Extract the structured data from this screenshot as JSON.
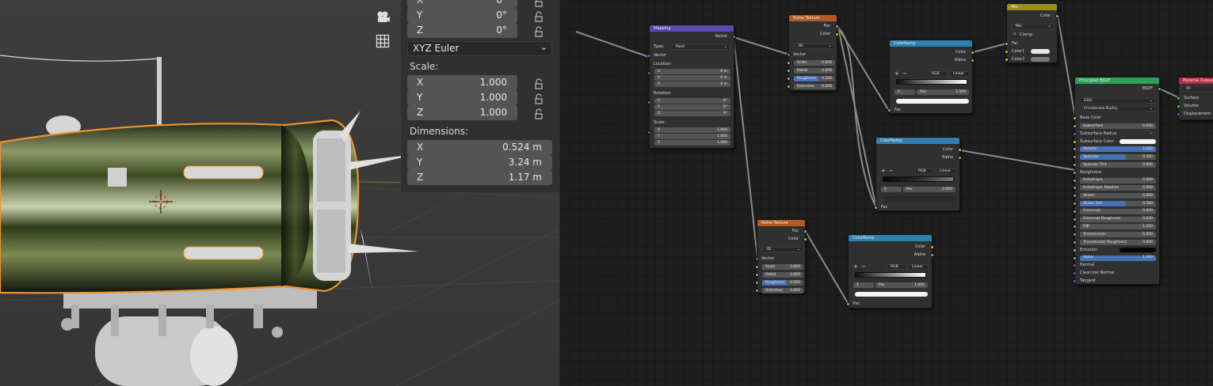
{
  "viewport": {
    "gizmos": [
      "camera-icon",
      "grid-icon"
    ],
    "rotation_rows": [
      {
        "axis": "X",
        "value": "0°"
      },
      {
        "axis": "Y",
        "value": "0°"
      },
      {
        "axis": "Z",
        "value": "0°"
      }
    ],
    "rotation_mode": "XYZ Euler",
    "scale_label": "Scale:",
    "scale_rows": [
      {
        "axis": "X",
        "value": "1.000"
      },
      {
        "axis": "Y",
        "value": "1.000"
      },
      {
        "axis": "Z",
        "value": "1.000"
      }
    ],
    "dimensions_label": "Dimensions:",
    "dimension_rows": [
      {
        "axis": "X",
        "value": "0.524 m"
      },
      {
        "axis": "Y",
        "value": "3.24 m"
      },
      {
        "axis": "Z",
        "value": "1.17 m"
      }
    ]
  },
  "node_editor": {
    "mapping": {
      "title": "Mapping",
      "out_vector": "Vector",
      "type_label": "Type:",
      "type_value": "Point",
      "in_vector": "Vector",
      "location_label": "Location:",
      "location": [
        {
          "a": "X",
          "v": "0 m"
        },
        {
          "a": "Y",
          "v": "0 m"
        },
        {
          "a": "Z",
          "v": "0 m"
        }
      ],
      "rotation_label": "Rotation:",
      "rotation": [
        {
          "a": "X",
          "v": "0°"
        },
        {
          "a": "Y",
          "v": "0°"
        },
        {
          "a": "Z",
          "v": "0°"
        }
      ],
      "scale_label": "Scale:",
      "scale": [
        {
          "a": "X",
          "v": "1.000"
        },
        {
          "a": "Y",
          "v": "1.000"
        },
        {
          "a": "Z",
          "v": "1.000"
        }
      ]
    },
    "noise1": {
      "title": "Noise Texture",
      "out_fac": "Fac",
      "out_color": "Color",
      "dim": "3D",
      "in_vector": "Vector",
      "fields": [
        {
          "a": "Scale",
          "v": "5.000"
        },
        {
          "a": "Detail",
          "v": "4.000"
        },
        {
          "a": "Roughness",
          "v": "0.500"
        },
        {
          "a": "Distortion",
          "v": "0.000"
        }
      ]
    },
    "noise2": {
      "title": "Noise Texture",
      "out_fac": "Fac",
      "out_color": "Color",
      "dim": "3D",
      "in_vector": "Vector",
      "fields": [
        {
          "a": "Scale",
          "v": "5.000"
        },
        {
          "a": "Detail",
          "v": "2.000"
        },
        {
          "a": "Roughness",
          "v": "0.500"
        },
        {
          "a": "Distortion",
          "v": "0.000"
        }
      ]
    },
    "ramp1": {
      "title": "ColorRamp",
      "out_color": "Color",
      "out_alpha": "Alpha",
      "mode": "RGB",
      "interp": "Linear",
      "index": "1",
      "pos_label": "Pos",
      "pos": "1.000",
      "in_fac": "Fac"
    },
    "ramp2": {
      "title": "ColorRamp",
      "out_color": "Color",
      "out_alpha": "Alpha",
      "mode": "RGB",
      "interp": "Linear",
      "index": "0",
      "pos_label": "Pos",
      "pos": "0.000",
      "in_fac": "Fac"
    },
    "ramp3": {
      "title": "ColorRamp",
      "out_color": "Color",
      "out_alpha": "Alpha",
      "mode": "RGB",
      "interp": "Linear",
      "index": "1",
      "pos_label": "Pos",
      "pos": "1.000",
      "in_fac": "Fac"
    },
    "mix": {
      "title": "Mix",
      "out_color": "Color",
      "blend": "Mix",
      "clamp": "Clamp",
      "fac": "Fac",
      "color1": "Color1",
      "color2": "Color2"
    },
    "bsdf": {
      "title": "Principled BSDF",
      "out": "BSDF",
      "distribution": "GGX",
      "subsurface_method": "Christensen-Burley",
      "base_color": "Base Color",
      "rows": [
        {
          "a": "Subsurface",
          "v": "0.000",
          "s": "g"
        },
        {
          "a": "Subsurface Radius",
          "v": "",
          "s": "p",
          "dd": true
        },
        {
          "a": "Subsurface Color",
          "v": "",
          "s": "y",
          "sw": true
        },
        {
          "a": "Metallic",
          "v": "1.000",
          "s": "g",
          "full": true
        },
        {
          "a": "Specular",
          "v": "0.500",
          "s": "g",
          "blue": true
        },
        {
          "a": "Specular Tint",
          "v": "0.000",
          "s": "g"
        },
        {
          "a": "Roughness",
          "v": "",
          "s": "g",
          "plain": true
        },
        {
          "a": "Anisotropic",
          "v": "0.000",
          "s": "g"
        },
        {
          "a": "Anisotropic Rotation",
          "v": "0.000",
          "s": "g"
        },
        {
          "a": "Sheen",
          "v": "0.000",
          "s": "g"
        },
        {
          "a": "Sheen Tint",
          "v": "0.500",
          "s": "g",
          "blue": true
        },
        {
          "a": "Clearcoat",
          "v": "0.000",
          "s": "g"
        },
        {
          "a": "Clearcoat Roughness",
          "v": "0.030",
          "s": "g"
        },
        {
          "a": "IOR",
          "v": "1.450",
          "s": "g"
        },
        {
          "a": "Transmission",
          "v": "0.000",
          "s": "g"
        },
        {
          "a": "Transmission Roughness",
          "v": "0.000",
          "s": "g"
        },
        {
          "a": "Emission",
          "v": "",
          "s": "y",
          "black": true
        },
        {
          "a": "Alpha",
          "v": "1.000",
          "s": "g",
          "full": true
        },
        {
          "a": "Normal",
          "v": "",
          "s": "p",
          "plain": true
        },
        {
          "a": "Clearcoat Normal",
          "v": "",
          "s": "p",
          "plain": true
        },
        {
          "a": "Tangent",
          "v": "",
          "s": "p",
          "plain": true
        }
      ]
    },
    "output": {
      "title": "Material Output",
      "target": "All",
      "surface": "Surface",
      "volume": "Volume",
      "displacement": "Displacement"
    }
  },
  "colors": {
    "selection_outline": "#f0922c",
    "tex_header": "#b15a23",
    "vector_header": "#5c49b0",
    "converter_header": "#2f80b0",
    "shader_header": "#2aa35a",
    "output_header": "#b52f3e"
  }
}
